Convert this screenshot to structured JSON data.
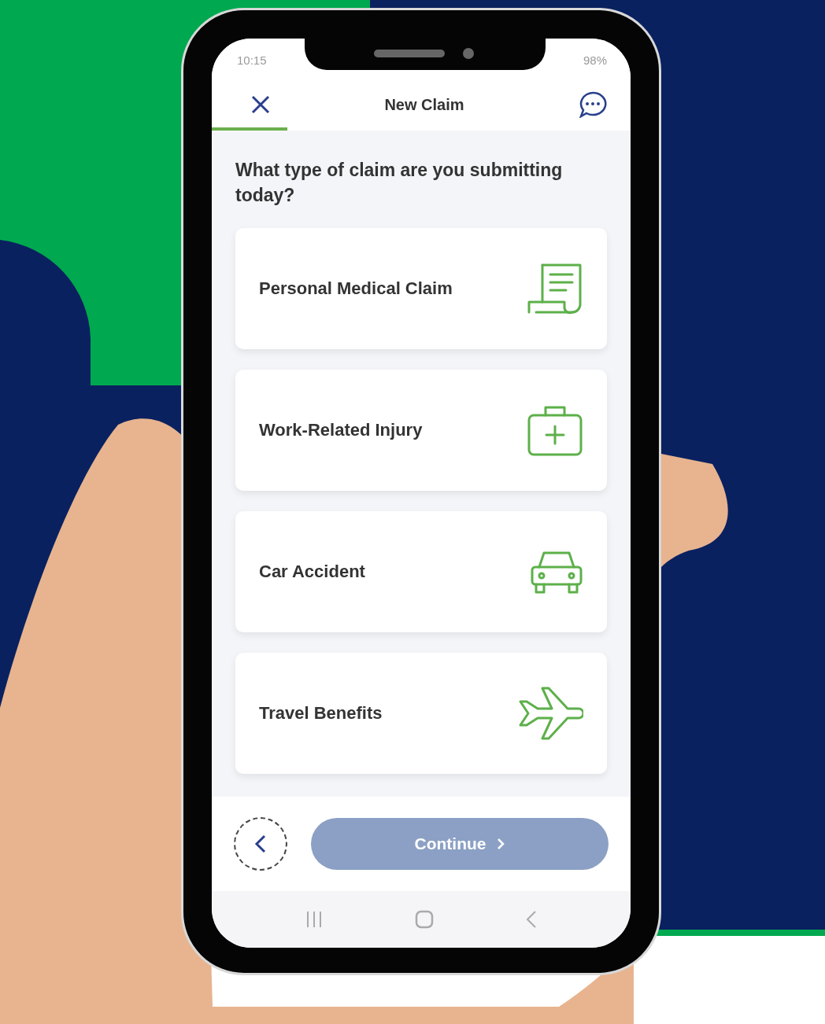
{
  "status_bar": {
    "time": "10:15",
    "battery": "98%"
  },
  "header": {
    "title": "New Claim",
    "progress": {
      "level": 0.18
    }
  },
  "question": "What type of claim are you submitting today?",
  "options": [
    {
      "label": "Personal Medical Claim",
      "kind": "receipt"
    },
    {
      "label": "Work-Related Injury",
      "kind": "firstaid"
    },
    {
      "label": "Car Accident",
      "kind": "car"
    },
    {
      "label": "Travel Benefits",
      "kind": "plane"
    }
  ],
  "footer": {
    "continue": {
      "label": "Continue",
      "disabled": true
    }
  }
}
